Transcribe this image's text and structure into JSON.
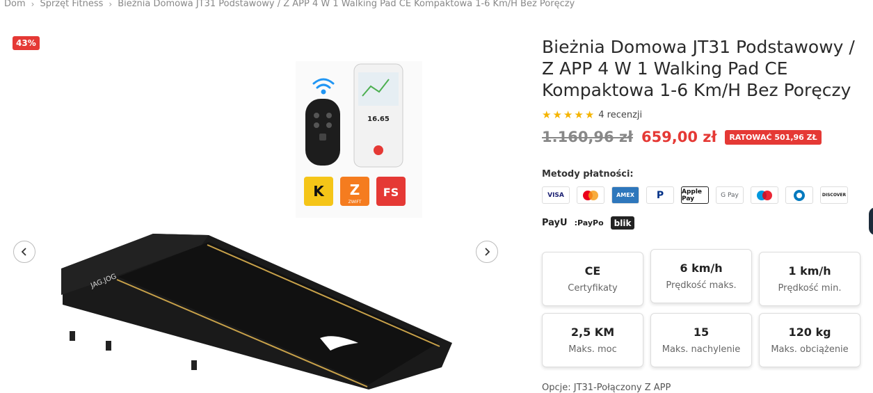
{
  "breadcrumb": {
    "items": [
      "Dom",
      "Sprzęt Fitness",
      "Bieżnia Domowa JT31 Podstawowy / Z APP 4 W 1 Walking Pad CE Kompaktowa 1-6 Km/H Bez Poręczy"
    ]
  },
  "gallery": {
    "discount_badge": "43%",
    "screen_value": "16.65",
    "brand_text": "JAG.JOG",
    "app_badges": [
      "K",
      "Z",
      "FS"
    ],
    "app_badge_caption": "ZWIFT"
  },
  "product": {
    "title": "Bieżnia Domowa JT31 Podstawowy / Z APP 4 W 1 Walking Pad CE Kompaktowa 1-6 Km/H Bez Poręczy",
    "rating_stars": 5,
    "review_count": "4 recenzji",
    "old_price": "1.160,96 zł",
    "new_price": "659,00 zł",
    "save_badge": "RATOWAĆ 501,96 ZŁ"
  },
  "payments": {
    "label": "Metody płatności:",
    "row1": [
      "VISA",
      "mastercard",
      "AMEX",
      "PayPal",
      "Apple Pay",
      "G Pay",
      "maestro",
      "Diners",
      "DISCOVER"
    ],
    "row2": [
      "PayU",
      ":PayPo",
      "blik"
    ]
  },
  "specs": [
    {
      "value": "CE",
      "label": "Certyfikaty"
    },
    {
      "value": "6 km/h",
      "label": "Prędkość maks."
    },
    {
      "value": "1 km/h",
      "label": "Prędkość min."
    },
    {
      "value": "2,5 KM",
      "label": "Maks. moc"
    },
    {
      "value": "15",
      "label": "Maks. nachylenie"
    },
    {
      "value": "120 kg",
      "label": "Maks. obciążenie"
    }
  ],
  "option": {
    "label": "Opcje:",
    "value": "JT31-Połączony Z APP"
  },
  "colors": {
    "accent_red": "#e53935",
    "star": "#f5b400"
  }
}
